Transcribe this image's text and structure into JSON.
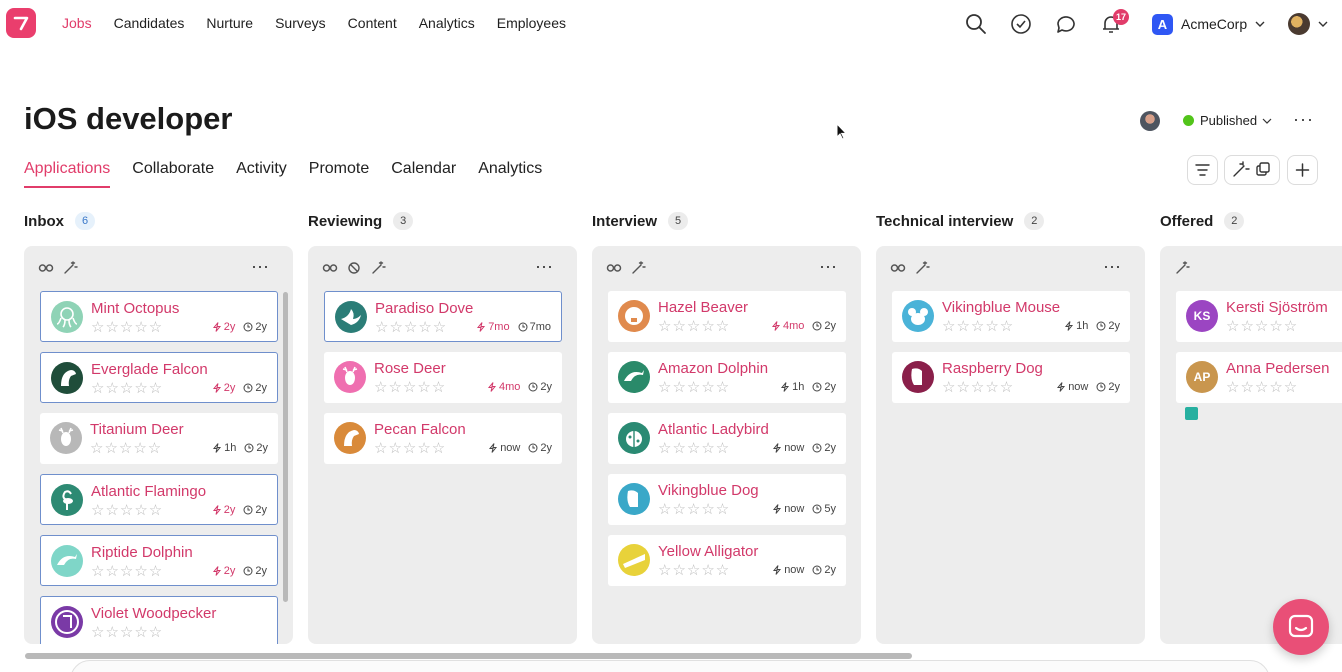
{
  "nav": {
    "items": [
      "Jobs",
      "Candidates",
      "Nurture",
      "Surveys",
      "Content",
      "Analytics",
      "Employees"
    ],
    "notifications_count": "17",
    "company_initial": "A",
    "company_name": "AcmeCorp"
  },
  "header": {
    "title": "iOS developer",
    "status": "Published",
    "status_color": "#52c41a"
  },
  "tabs": [
    "Applications",
    "Collaborate",
    "Activity",
    "Promote",
    "Calendar",
    "Analytics"
  ],
  "columns": [
    {
      "title": "Inbox",
      "count": "6",
      "cards": [
        {
          "name": "Mint Octopus",
          "icon": "octopus",
          "color": "#8fd3b6",
          "activity": "2y",
          "activity_red": true,
          "created": "2y",
          "highlight": true
        },
        {
          "name": "Everglade Falcon",
          "icon": "falcon",
          "color": "#1f4d3a",
          "activity": "2y",
          "activity_red": true,
          "created": "2y",
          "highlight": true
        },
        {
          "name": "Titanium Deer",
          "icon": "deer",
          "color": "#b8b8b8",
          "activity": "1h",
          "activity_red": false,
          "created": "2y",
          "highlight": false
        },
        {
          "name": "Atlantic Flamingo",
          "icon": "flamingo",
          "color": "#2d8a73",
          "activity": "2y",
          "activity_red": true,
          "created": "2y",
          "highlight": true
        },
        {
          "name": "Riptide Dolphin",
          "icon": "dolphin",
          "color": "#7fd6c8",
          "activity": "2y",
          "activity_red": true,
          "created": "2y",
          "highlight": true
        },
        {
          "name": "Violet Woodpecker",
          "icon": "woodpecker",
          "color": "#7a3aa6",
          "activity": "",
          "activity_red": false,
          "created": "",
          "highlight": true
        }
      ]
    },
    {
      "title": "Reviewing",
      "count": "3",
      "cards": [
        {
          "name": "Paradiso Dove",
          "icon": "dove",
          "color": "#2b7d77",
          "activity": "7mo",
          "activity_red": true,
          "created": "7mo",
          "highlight": true
        },
        {
          "name": "Rose Deer",
          "icon": "deer",
          "color": "#ef6fb0",
          "activity": "4mo",
          "activity_red": true,
          "created": "2y",
          "highlight": false
        },
        {
          "name": "Pecan Falcon",
          "icon": "falcon",
          "color": "#d98a3a",
          "activity": "now",
          "activity_red": false,
          "created": "2y",
          "highlight": false
        }
      ]
    },
    {
      "title": "Interview",
      "count": "5",
      "cards": [
        {
          "name": "Hazel Beaver",
          "icon": "beaver",
          "color": "#e08a4d",
          "activity": "4mo",
          "activity_red": true,
          "created": "2y",
          "highlight": false
        },
        {
          "name": "Amazon Dolphin",
          "icon": "dolphin",
          "color": "#2a8a6a",
          "activity": "1h",
          "activity_red": false,
          "created": "2y",
          "highlight": false
        },
        {
          "name": "Atlantic Ladybird",
          "icon": "ladybird",
          "color": "#2a8a73",
          "activity": "now",
          "activity_red": false,
          "created": "2y",
          "highlight": false
        },
        {
          "name": "Vikingblue Dog",
          "icon": "dog",
          "color": "#3aa8c8",
          "activity": "now",
          "activity_red": false,
          "created": "5y",
          "highlight": false
        },
        {
          "name": "Yellow Alligator",
          "icon": "alligator",
          "color": "#e8d23a",
          "activity": "now",
          "activity_red": false,
          "created": "2y",
          "highlight": false
        }
      ]
    },
    {
      "title": "Technical interview",
      "count": "2",
      "cards": [
        {
          "name": "Vikingblue Mouse",
          "icon": "mouse",
          "color": "#4ab3d8",
          "activity": "1h",
          "activity_red": false,
          "created": "2y",
          "highlight": false
        },
        {
          "name": "Raspberry Dog",
          "icon": "dog",
          "color": "#8a1f4a",
          "activity": "now",
          "activity_red": false,
          "created": "2y",
          "highlight": false
        }
      ]
    },
    {
      "title": "Offered",
      "count": "2",
      "cards": [
        {
          "name": "Kersti Sjöström",
          "initials": "KS",
          "color": "#9b45c2",
          "highlight": false
        },
        {
          "name": "Anna Pedersen",
          "initials": "AP",
          "color": "#c9964e",
          "highlight": false
        }
      ]
    }
  ],
  "stars": "☆☆☆☆☆"
}
